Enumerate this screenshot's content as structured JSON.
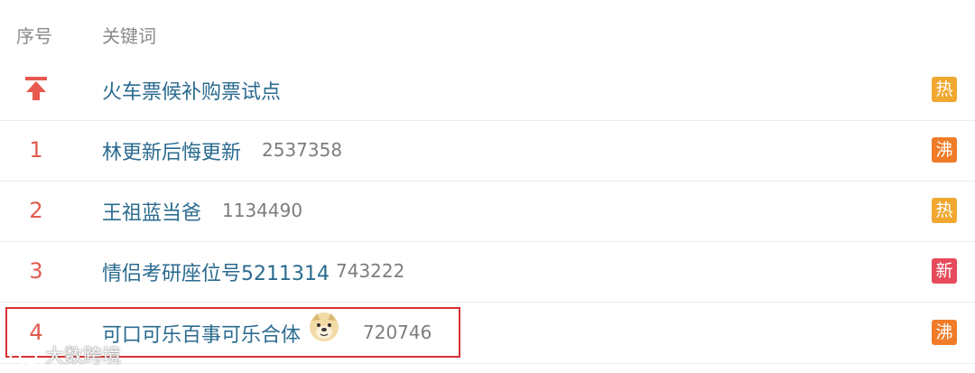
{
  "header": {
    "rank_label": "序号",
    "keyword_label": "关键词"
  },
  "rows": [
    {
      "rank": "",
      "keyword": "火车票候补购票试点",
      "count": "",
      "badge": "热",
      "badge_color": "#f0a830",
      "pinned": true
    },
    {
      "rank": "1",
      "keyword": "林更新后悔更新",
      "count": "2537358",
      "badge": "沸",
      "badge_color": "#f07c27"
    },
    {
      "rank": "2",
      "keyword": "王祖蓝当爸",
      "count": "1134490",
      "badge": "热",
      "badge_color": "#f0a830"
    },
    {
      "rank": "3",
      "keyword": "情侣考研座位号5211314",
      "count": "743222",
      "badge": "新",
      "badge_color": "#e64a5c"
    },
    {
      "rank": "4",
      "keyword": "可口可乐百事可乐合体",
      "count": "720746",
      "badge": "沸",
      "badge_color": "#f07c27"
    }
  ],
  "watermark": {
    "text": "大数跨境"
  },
  "icons": {
    "pinned": "pin-to-top-icon",
    "emoji": "dog-face-emoji-icon"
  },
  "colors": {
    "keyword": "#2b6b8f",
    "rank": "#e05a4e",
    "highlight": "#d93030"
  }
}
